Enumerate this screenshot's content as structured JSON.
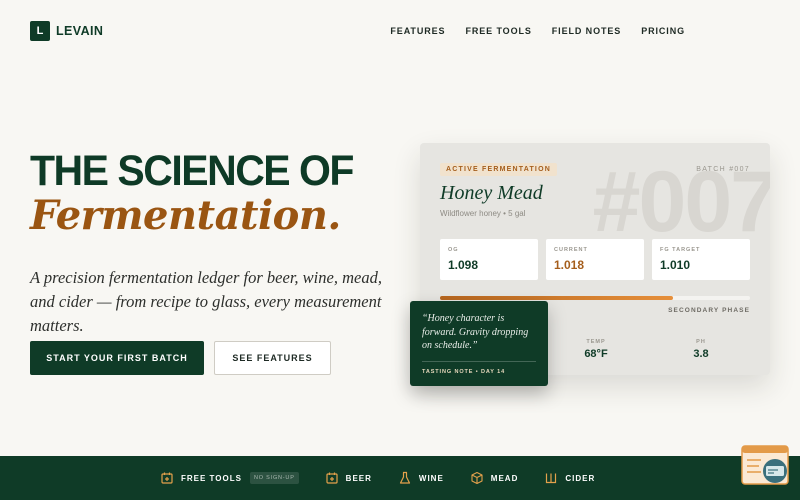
{
  "brand": {
    "mark": "L",
    "name": "LEVAIN"
  },
  "nav": {
    "items": [
      "FEATURES",
      "FREE TOOLS",
      "FIELD NOTES",
      "PRICING"
    ]
  },
  "hero": {
    "title_line1": "THE SCIENCE OF",
    "title_line2": "Fermentation.",
    "subtitle": "A precision fermentation ledger for beer, wine, mead, and cider — from recipe to glass, every measurement matters.",
    "primary_cta": "START YOUR FIRST BATCH",
    "secondary_cta": "SEE FEATURES"
  },
  "batch_card": {
    "badge": "ACTIVE FERMENTATION",
    "batch_id": "BATCH #007",
    "watermark": "#007",
    "name": "Honey Mead",
    "description": "Wildflower honey • 5 gal",
    "metrics": [
      {
        "label": "OG",
        "value": "1.098"
      },
      {
        "label": "CURRENT",
        "value": "1.018"
      },
      {
        "label": "FG TARGET",
        "value": "1.010"
      }
    ],
    "progress_fraction": 0.75,
    "phase": "SECONDARY PHASE",
    "stats": [
      {
        "label": "TEMP",
        "value": "68°F"
      },
      {
        "label": "PH",
        "value": "3.8"
      }
    ]
  },
  "tasting_note": {
    "quote": "“Honey character is forward. Gravity dropping on schedule.”",
    "caption": "TASTING NOTE • DAY 14"
  },
  "footer": {
    "items": [
      {
        "label": "FREE TOOLS",
        "icon": "calendar-plus-icon",
        "badge": "NO SIGN-UP"
      },
      {
        "label": "BEER",
        "icon": "calendar-plus-icon"
      },
      {
        "label": "WINE",
        "icon": "flask-icon"
      },
      {
        "label": "MEAD",
        "icon": "cube-icon"
      },
      {
        "label": "CIDER",
        "icon": "crown-icon"
      }
    ]
  },
  "colors": {
    "brand_green": "#0f3b27",
    "accent_amber": "#9a5512",
    "background": "#f8f7f3"
  }
}
